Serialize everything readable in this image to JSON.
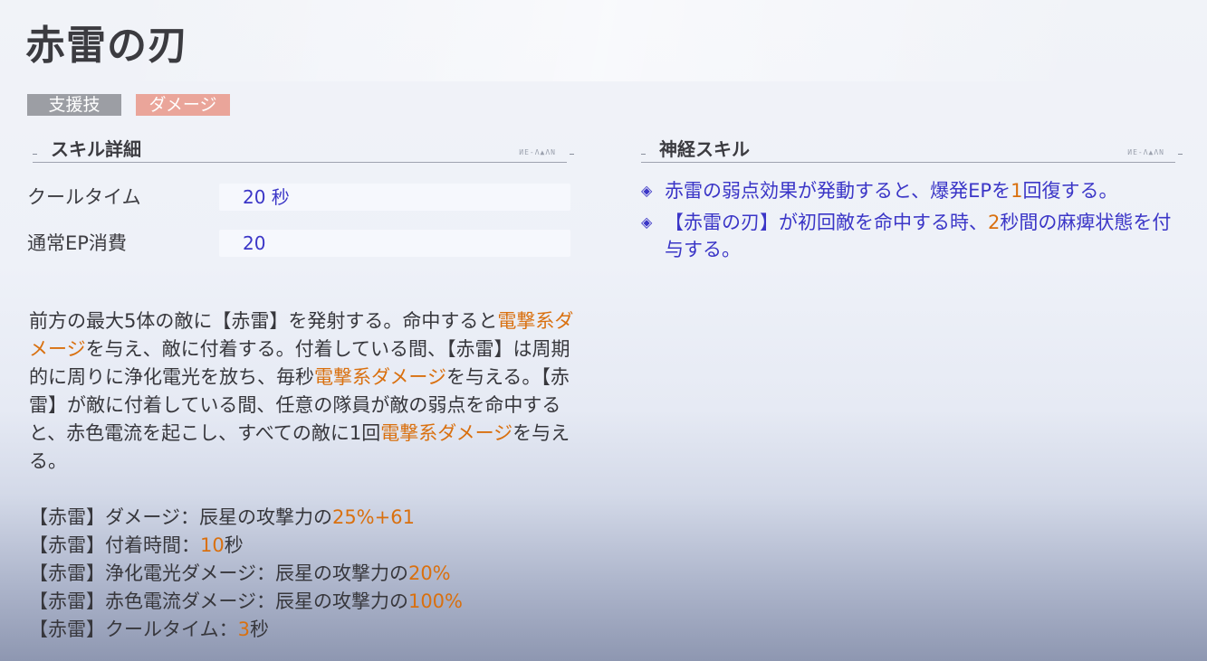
{
  "skill": {
    "title": "赤雷の刃",
    "tags": {
      "support": "支援技",
      "damage": "ダメージ"
    }
  },
  "colors": {
    "highlight": "#d9700f",
    "value_blue": "#3b36c7",
    "tag_support_bg": "#9c9ea4",
    "tag_damage_bg": "#eaa59a"
  },
  "details": {
    "header": "スキル詳細",
    "deco": "ИЕ-Λ▲ΛΝ",
    "cooldown": {
      "label": "クールタイム",
      "value": "20 秒"
    },
    "ep_cost": {
      "label": "通常EP消費",
      "value": "20"
    }
  },
  "description": [
    {
      "t": "前方の最大5体の敵に【赤雷】を発射する。命中すると",
      "hl": false
    },
    {
      "t": "電撃系ダメージ",
      "hl": true
    },
    {
      "t": "を与え、敵に付着する。付着している間、【赤雷】は周期的に周りに浄化電光を放ち、毎秒",
      "hl": false
    },
    {
      "t": "電撃系ダメージ",
      "hl": true
    },
    {
      "t": "を与える。【赤雷】が敵に付着している間、任意の隊員が敵の弱点を命中すると、赤色電流を起こし、すべての敵に1回",
      "hl": false
    },
    {
      "t": "電撃系ダメージ",
      "hl": true
    },
    {
      "t": "を与える。",
      "hl": false
    }
  ],
  "stats": [
    {
      "prefix": "【赤雷】ダメージ：辰星の攻撃力の",
      "value": "25%+61",
      "suffix": ""
    },
    {
      "prefix": "【赤雷】付着時間：",
      "value": "10",
      "suffix": "秒"
    },
    {
      "prefix": "【赤雷】浄化電光ダメージ：辰星の攻撃力の",
      "value": "20%",
      "suffix": ""
    },
    {
      "prefix": "【赤雷】赤色電流ダメージ：辰星の攻撃力の",
      "value": "100%",
      "suffix": ""
    },
    {
      "prefix": "【赤雷】クールタイム：",
      "value": "3",
      "suffix": "秒"
    }
  ],
  "neuro": {
    "header": "神経スキル",
    "deco": "ИЕ-Λ▲ΛΝ",
    "bullet_icon": "diamond-bullet-icon",
    "items": [
      [
        {
          "t": "赤雷の弱点効果が発動すると、爆発EPを",
          "hl": false
        },
        {
          "t": "1",
          "hl": true
        },
        {
          "t": "回復する。",
          "hl": false
        }
      ],
      [
        {
          "t": "【赤雷の刃】が初回敵を命中する時、",
          "hl": false
        },
        {
          "t": "2",
          "hl": true
        },
        {
          "t": "秒間の麻痺状態を付与する。",
          "hl": false
        }
      ]
    ]
  }
}
